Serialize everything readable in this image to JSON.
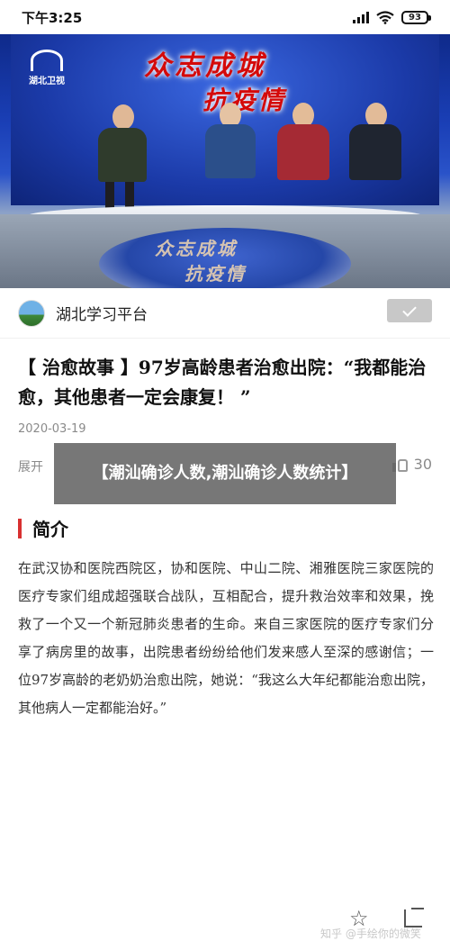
{
  "status_bar": {
    "time": "下午3:25",
    "battery": "93"
  },
  "video": {
    "channel_logo_text": "湖北卫视",
    "backdrop_title_line1": "众志成城",
    "backdrop_title_line2": "抗疫情",
    "desk_text_line1": "众志成城",
    "desk_text_line2": "抗疫情"
  },
  "account": {
    "name": "湖北学习平台"
  },
  "article": {
    "title": "【 治愈故事 】97岁高龄患者治愈出院：“我都能治愈，其他患者一定会康复！ ”",
    "date": "2020-03-19",
    "expand_label": "展开",
    "like_count": "30",
    "section_title": "简介",
    "body": "在武汉协和医院西院区，协和医院、中山二院、湘雅医院三家医院的医疗专家们组成超强联合战队，互相配合，提升救治效率和效果，挽救了一个又一个新冠肺炎患者的生命。来自三家医院的医疗专家们分享了病房里的故事，出院患者纷纷给他们发来感人至深的感谢信；一位97岁高龄的老奶奶治愈出院，她说：“我这么大年纪都能治愈出院，其他病人一定都能治好。”"
  },
  "overlay": {
    "banner_text": "【潮汕确诊人数,潮汕确诊人数统计】"
  },
  "bottom": {
    "watermark": "知乎 @手绘你的微笑"
  },
  "colors": {
    "accent_red": "#d83030",
    "follow_button": "#c8c8c8",
    "overlay_bg": "#5f5f5f"
  }
}
